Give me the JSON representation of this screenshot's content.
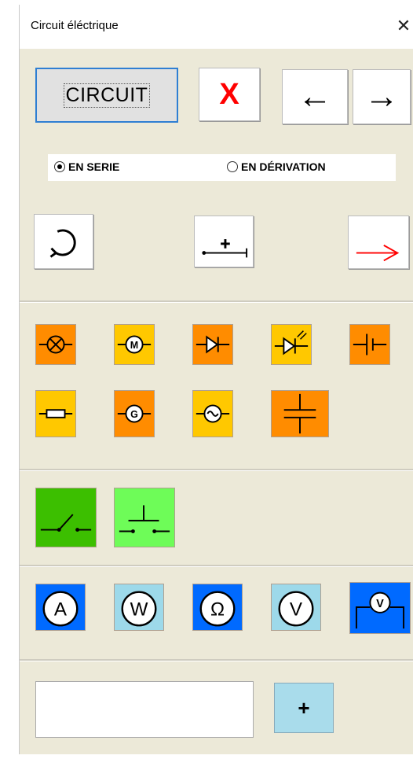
{
  "window": {
    "title": "Circuit éléctrique",
    "close_glyph": "✕"
  },
  "toolbar": {
    "circuit_label": "CIRCUIT",
    "delete_glyph": "X",
    "back_glyph": "←",
    "forward_glyph": "→"
  },
  "mode": {
    "options": [
      {
        "label": "EN SERIE",
        "selected": true
      },
      {
        "label": "EN DÉRIVATION",
        "selected": false
      }
    ]
  },
  "tools": {
    "rotate_icon": "rotate-icon",
    "add_wire_glyph": "+",
    "arrow_icon": "red-arrow-icon"
  },
  "components": {
    "row1": [
      {
        "name": "lamp",
        "color": "#ff8c00",
        "glyph": "⊗"
      },
      {
        "name": "motor",
        "color": "#ffc800",
        "glyph": "M"
      },
      {
        "name": "diode",
        "color": "#ff8c00",
        "glyph": ""
      },
      {
        "name": "led",
        "color": "#ffc800",
        "glyph": ""
      },
      {
        "name": "battery",
        "color": "#ff8c00",
        "glyph": ""
      }
    ],
    "row2": [
      {
        "name": "resistor",
        "color": "#ffc800",
        "glyph": ""
      },
      {
        "name": "generator",
        "color": "#ff8c00",
        "glyph": "G"
      },
      {
        "name": "ac-source",
        "color": "#ffc800",
        "glyph": "~"
      },
      {
        "name": "capacitor",
        "color": "#ff8c00",
        "glyph": ""
      }
    ]
  },
  "switches": [
    {
      "name": "switch",
      "color": "#3cbf00"
    },
    {
      "name": "push-button",
      "color": "#6efc58"
    }
  ],
  "meters": [
    {
      "name": "ammeter",
      "color": "#006aff",
      "letter": "A"
    },
    {
      "name": "wattmeter",
      "color": "#9dd9ea",
      "letter": "W"
    },
    {
      "name": "ohmmeter",
      "color": "#006aff",
      "letter": "Ω"
    },
    {
      "name": "voltmeter",
      "color": "#9dd9ea",
      "letter": "V"
    },
    {
      "name": "voltmeter-branch",
      "color": "#006aff",
      "letter": "V"
    }
  ],
  "bottom": {
    "input_value": "",
    "add_label": "+"
  }
}
